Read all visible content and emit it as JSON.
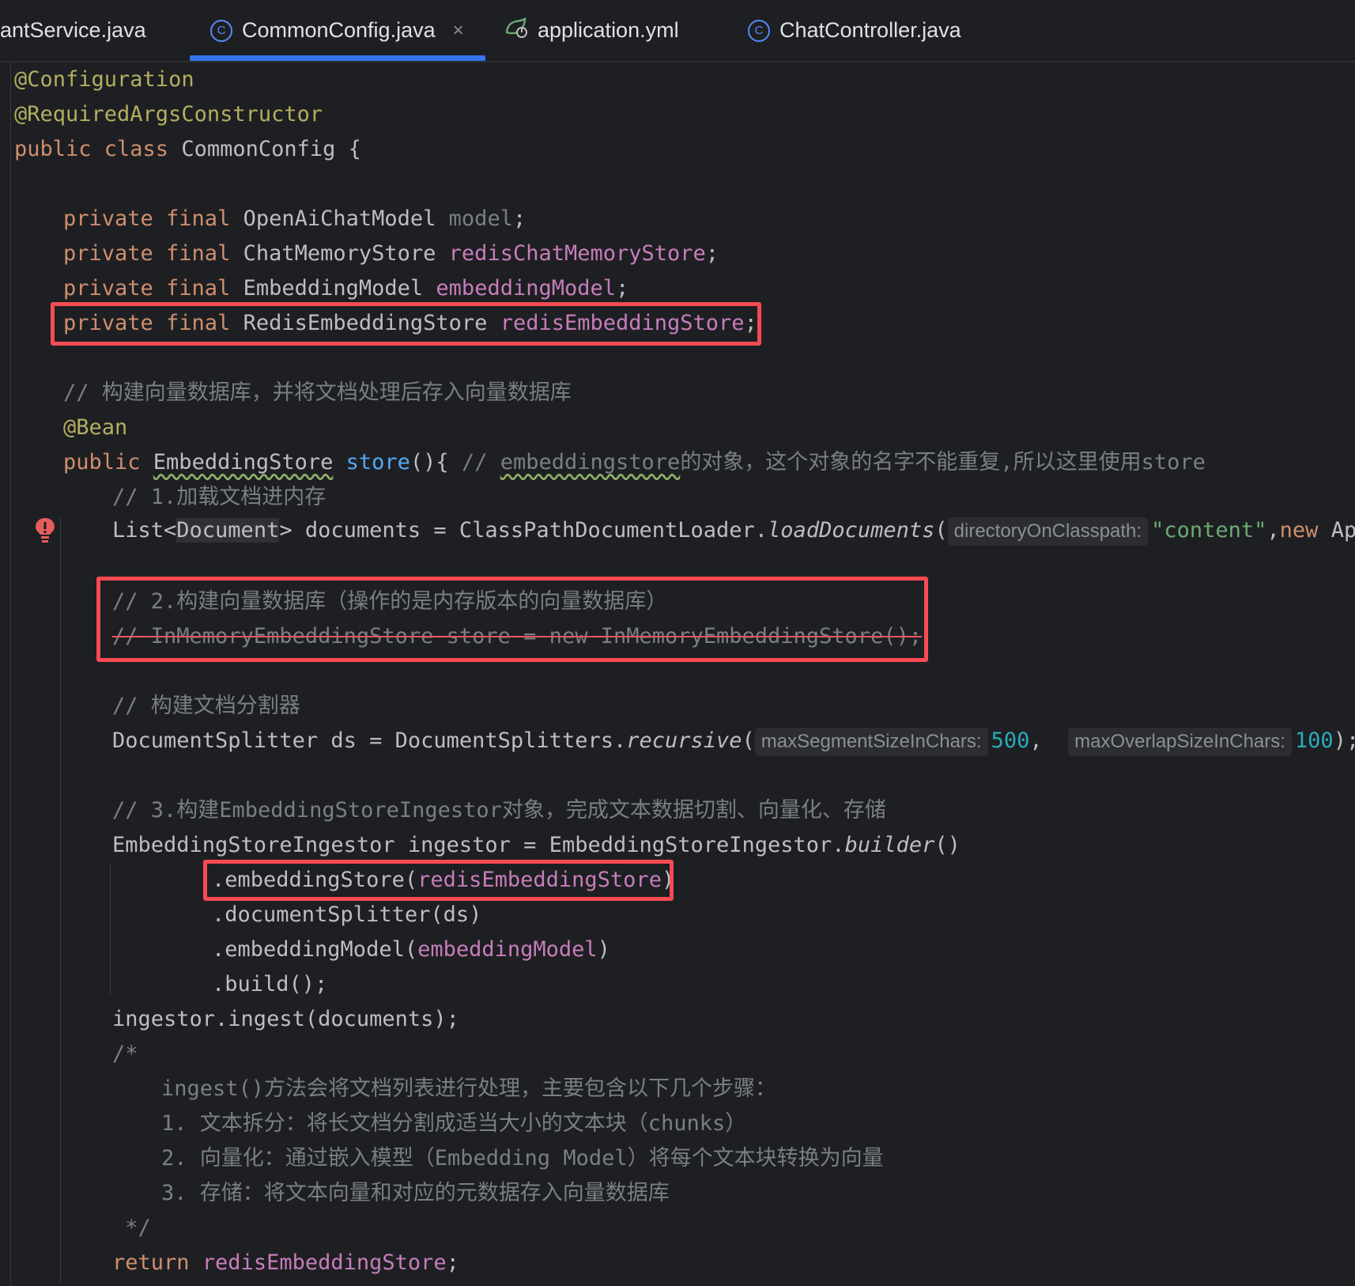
{
  "tabs": [
    {
      "label": "antService.java"
    },
    {
      "label": "CommonConfig.java",
      "active": true
    },
    {
      "label": "application.yml"
    },
    {
      "label": "ChatController.java"
    }
  ],
  "close_glyph": "×",
  "code": {
    "l1": "@Configuration",
    "l2": "@RequiredArgsConstructor",
    "l3_kw": "public class",
    "l3_rest": " CommonConfig {",
    "f_kw": "private final",
    "f1_type": " OpenAiChatModel ",
    "f1_name": "model",
    "f2_type": " ChatMemoryStore ",
    "f2_name": "redisChatMemoryStore",
    "f3_type": " EmbeddingModel ",
    "f3_name": "embeddingModel",
    "f4_type": " RedisEmbeddingStore ",
    "f4_name": "redisEmbeddingStore",
    "semi": ";",
    "c1": "// 构建向量数据库，并将文档处理后存入向量数据库",
    "bean": "@Bean",
    "m_kw": "public ",
    "m_type": "EmbeddingStore",
    "m_name": "store",
    "m_paren": "(){ ",
    "m_cmt_a": "// ",
    "m_cmt_b": "embeddingstore",
    "m_cmt_c": "的对象，这个对象的名字不能重复,所以这里使用store",
    "c2": "// 1.加载文档进内存",
    "load_a": "List<",
    "load_b": "Document",
    "load_c": "> documents = ClassPathDocumentLoader.",
    "load_fn": "loadDocuments",
    "load_paren": "(",
    "load_hint": "directoryOnClasspath:",
    "load_str": "\"content\"",
    "load_comma": ",",
    "load_new": "new",
    "load_tail": " Apac",
    "c3": "// 2.构建向量数据库（操作的是内存版本的向量数据库）",
    "c4": "// InMemoryEmbeddingStore store = new InMemoryEmbeddingStore();",
    "c5": "// 构建文档分割器",
    "split_a": "DocumentSplitter ds = DocumentSplitters.",
    "split_fn": "recursive",
    "split_paren": "(",
    "split_hint1": "maxSegmentSizeInChars:",
    "split_n1": "500",
    "split_comma": ",  ",
    "split_hint2": "maxOverlapSizeInChars:",
    "split_n2": "100",
    "split_end": ");",
    "c6": "// 3.构建EmbeddingStoreIngestor对象，完成文本数据切割、向量化、存储",
    "ing_a": "EmbeddingStoreIngestor ingestor = EmbeddingStoreIngestor.",
    "ing_fn": "builder",
    "ing_end": "()",
    "b1_a": ".embeddingStore(",
    "b1_b": "redisEmbeddingStore",
    "b1_c": ")",
    "b2": ".documentSplitter(ds)",
    "b3_a": ".embeddingModel(",
    "b3_b": "embeddingModel",
    "b3_c": ")",
    "b4": ".build();",
    "ingest": "ingestor.ingest(documents);",
    "bc1": "/*",
    "bc2": "ingest()方法会将文档列表进行处理，主要包含以下几个步骤：",
    "bc3": "1. 文本拆分：将长文档分割成适当大小的文本块（chunks）",
    "bc4": "2. 向量化：通过嵌入模型（Embedding Model）将每个文本块转换为向量",
    "bc5": "3. 存储：将文本向量和对应的元数据存入向量数据库",
    "bc6": " */",
    "ret_kw": "return ",
    "ret_name": "redisEmbeddingStore",
    "ret_semi": ";"
  },
  "colors": {
    "keyword": "#cf8e6d",
    "annotation": "#b3ae60",
    "field": "#c77dbb",
    "comment": "#7a7e85",
    "string": "#6aab73",
    "number": "#2aacb8",
    "highlight_box": "#f74b53"
  }
}
